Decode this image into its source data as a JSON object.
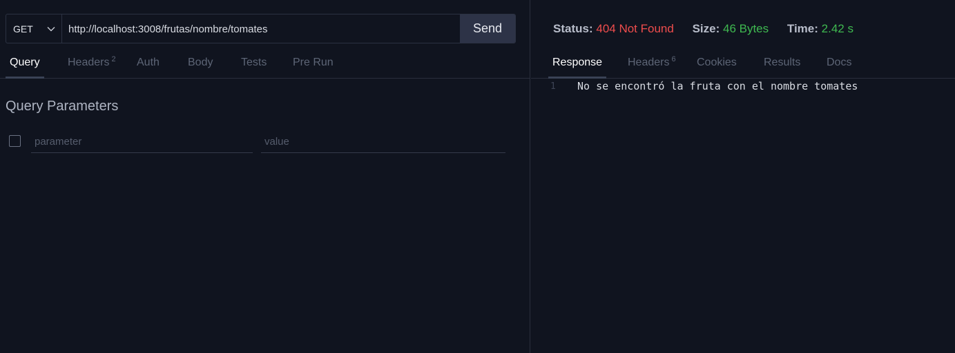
{
  "request": {
    "method": "GET",
    "url": "http://localhost:3008/frutas/nombre/tomates",
    "send_label": "Send"
  },
  "request_tabs": [
    {
      "label": "Query",
      "badge": ""
    },
    {
      "label": "Headers",
      "badge": "2"
    },
    {
      "label": "Auth",
      "badge": ""
    },
    {
      "label": "Body",
      "badge": ""
    },
    {
      "label": "Tests",
      "badge": ""
    },
    {
      "label": "Pre Run",
      "badge": ""
    }
  ],
  "query": {
    "title": "Query Parameters",
    "parameter_placeholder": "parameter",
    "value_placeholder": "value"
  },
  "status": {
    "status_label": "Status:",
    "status_value": "404 Not Found",
    "size_label": "Size:",
    "size_value": "46 Bytes",
    "time_label": "Time:",
    "time_value": "2.42 s"
  },
  "response_tabs": [
    {
      "label": "Response",
      "badge": ""
    },
    {
      "label": "Headers",
      "badge": "6"
    },
    {
      "label": "Cookies",
      "badge": ""
    },
    {
      "label": "Results",
      "badge": ""
    },
    {
      "label": "Docs",
      "badge": ""
    }
  ],
  "response": {
    "line_number": "1",
    "body": "No se encontró la fruta con el nombre tomates"
  },
  "colors": {
    "background": "#10141f",
    "error": "#ef4d4d",
    "success": "#3fb950",
    "send_button": "#2d3347"
  },
  "icons": {
    "method_dropdown": "chevron-down-icon"
  }
}
